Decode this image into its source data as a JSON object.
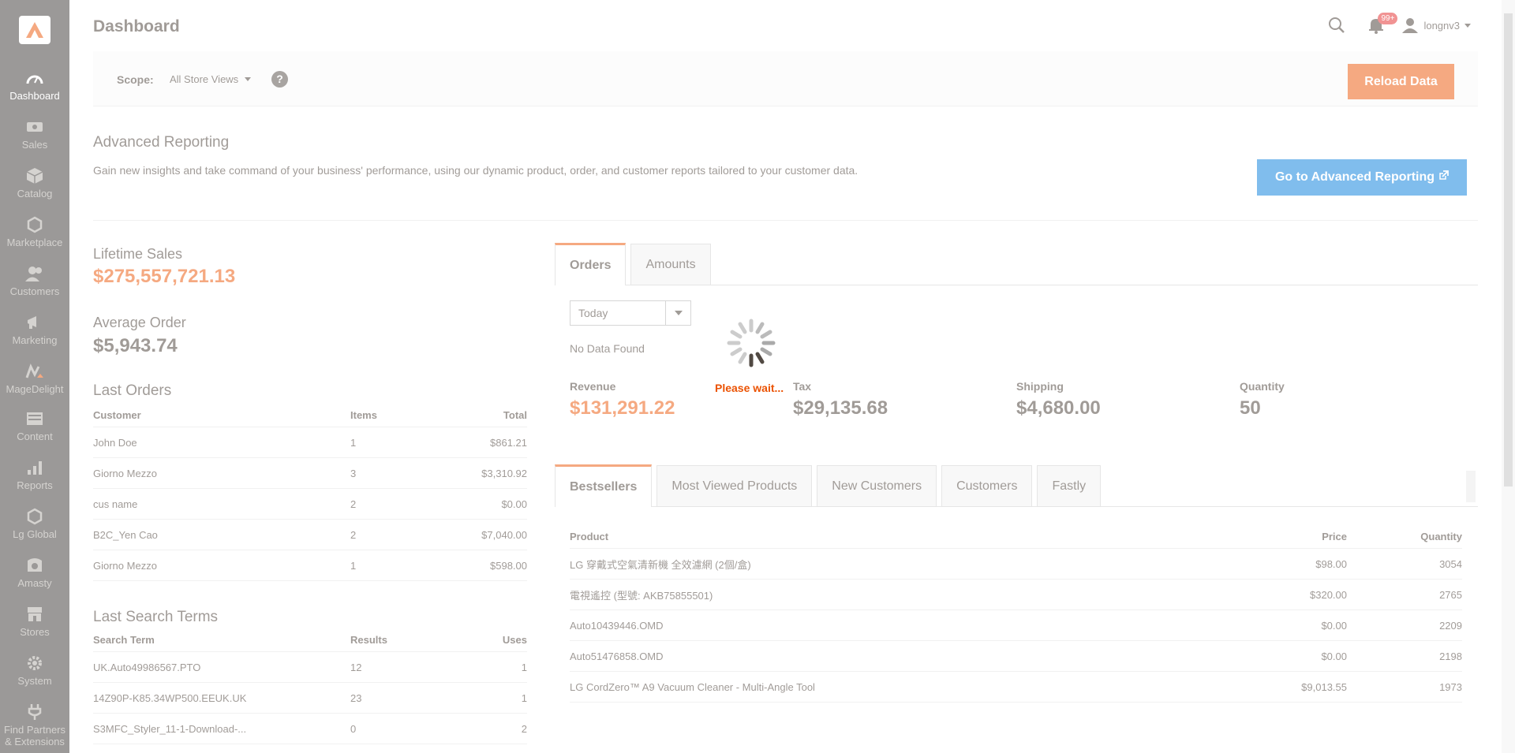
{
  "sidebar": {
    "items": [
      {
        "label": "Dashboard",
        "icon": "dashboard-icon"
      },
      {
        "label": "Sales",
        "icon": "sales-icon"
      },
      {
        "label": "Catalog",
        "icon": "catalog-icon"
      },
      {
        "label": "Marketplace",
        "icon": "marketplace-icon"
      },
      {
        "label": "Customers",
        "icon": "customers-icon"
      },
      {
        "label": "Marketing",
        "icon": "marketing-icon"
      },
      {
        "label": "MageDelight",
        "icon": "magedelight-icon"
      },
      {
        "label": "Content",
        "icon": "content-icon"
      },
      {
        "label": "Reports",
        "icon": "reports-icon"
      },
      {
        "label": "Lg Global",
        "icon": "lg-global-icon"
      },
      {
        "label": "Amasty",
        "icon": "amasty-icon"
      },
      {
        "label": "Stores",
        "icon": "stores-icon"
      },
      {
        "label": "System",
        "icon": "system-icon"
      },
      {
        "label": "Find Partners & Extensions",
        "icon": "extensions-icon"
      }
    ]
  },
  "header": {
    "title": "Dashboard",
    "notifications_badge": "99+",
    "username": "longnv3"
  },
  "scope": {
    "label": "Scope:",
    "value": "All Store Views",
    "help": "?",
    "reload_label": "Reload Data"
  },
  "advanced": {
    "title": "Advanced Reporting",
    "description": "Gain new insights and take command of your business' performance, using our dynamic product, order, and customer reports tailored to your customer data.",
    "button_label": "Go to Advanced Reporting"
  },
  "stats": {
    "lifetime_label": "Lifetime Sales",
    "lifetime_value": "$275,557,721.13",
    "average_label": "Average Order",
    "average_value": "$5,943.74"
  },
  "last_orders": {
    "title": "Last Orders",
    "headers": [
      "Customer",
      "Items",
      "Total"
    ],
    "rows": [
      [
        "John Doe",
        "1",
        "$861.21"
      ],
      [
        "Giorno Mezzo",
        "3",
        "$3,310.92"
      ],
      [
        "cus name",
        "2",
        "$0.00"
      ],
      [
        "B2C_Yen Cao",
        "2",
        "$7,040.00"
      ],
      [
        "Giorno Mezzo",
        "1",
        "$598.00"
      ]
    ]
  },
  "last_search": {
    "title": "Last Search Terms",
    "headers": [
      "Search Term",
      "Results",
      "Uses"
    ],
    "rows": [
      [
        "UK.Auto49986567.PTO",
        "12",
        "1"
      ],
      [
        "14Z90P-K85.34WP500.EEUK.UK",
        "23",
        "1"
      ],
      [
        "S3MFC_Styler_11-1-Download-...",
        "0",
        "2"
      ]
    ]
  },
  "chart_tabs": {
    "orders": "Orders",
    "amounts": "Amounts"
  },
  "period": "Today",
  "no_data": "No Data Found",
  "totals": {
    "revenue_label": "Revenue",
    "revenue_value": "$131,291.22",
    "tax_label": "Tax",
    "tax_value": "$29,135.68",
    "shipping_label": "Shipping",
    "shipping_value": "$4,680.00",
    "quantity_label": "Quantity",
    "quantity_value": "50"
  },
  "grid_tabs": [
    "Bestsellers",
    "Most Viewed Products",
    "New Customers",
    "Customers",
    "Fastly"
  ],
  "bestsellers": {
    "headers": [
      "Product",
      "Price",
      "Quantity"
    ],
    "rows": [
      [
        "LG 穿戴式空氣清新機 全效濾網 (2個/盒)",
        "$98.00",
        "3054"
      ],
      [
        "電視遙控 (型號: AKB75855501)",
        "$320.00",
        "2765"
      ],
      [
        "Auto10439446.OMD",
        "$0.00",
        "2209"
      ],
      [
        "Auto51476858.OMD",
        "$0.00",
        "2198"
      ],
      [
        "LG CordZero™ A9 Vacuum Cleaner - Multi-Angle Tool",
        "$9,013.55",
        "1973"
      ]
    ]
  },
  "loader": {
    "text": "Please wait..."
  },
  "colors": {
    "sidebar_bg": "#373330",
    "accent": "#eb5202",
    "link_button": "#007bdb"
  }
}
